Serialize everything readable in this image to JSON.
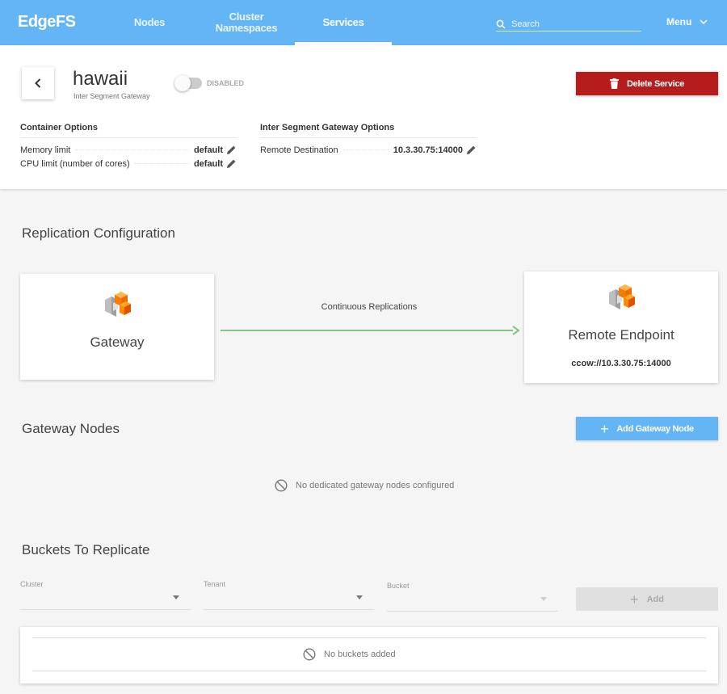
{
  "app": {
    "logo": "EdgeFS"
  },
  "nav": {
    "nodes": "Nodes",
    "namespaces_line1": "Cluster",
    "namespaces_line2": "Namespaces",
    "services": "Services",
    "search_placeholder": "Search",
    "menu": "Menu"
  },
  "service": {
    "name": "hawaii",
    "type": "Inter Segment Gateway",
    "status": "DISABLED",
    "enabled": false,
    "delete_label": "Delete Service"
  },
  "container_options": {
    "title": "Container Options",
    "rows": [
      {
        "label": "Memory limit",
        "value": "default"
      },
      {
        "label": "CPU limit (number of cores)",
        "value": "default"
      }
    ]
  },
  "isg_options": {
    "title": "Inter Segment Gateway Options",
    "rows": [
      {
        "label": "Remote Destination",
        "value": "10.3.30.75:14000"
      }
    ]
  },
  "replication": {
    "title": "Replication Configuration",
    "source_label": "Gateway",
    "link_label": "Continuous Replications",
    "target_label": "Remote Endpoint",
    "target_url": "ccow://10.3.30.75:14000"
  },
  "gateway_nodes": {
    "title": "Gateway Nodes",
    "add_label": "Add Gateway Node",
    "empty_message": "No dedicated gateway nodes configured"
  },
  "buckets": {
    "title": "Buckets To Replicate",
    "cluster_label": "Cluster",
    "tenant_label": "Tenant",
    "bucket_label": "Bucket",
    "add_label": "Add",
    "empty_message": "No buckets added"
  },
  "colors": {
    "topbar": "#64b5f6",
    "danger": "#b71c1c",
    "arrow": "#81c784",
    "logo_orange": "#f57c00"
  }
}
